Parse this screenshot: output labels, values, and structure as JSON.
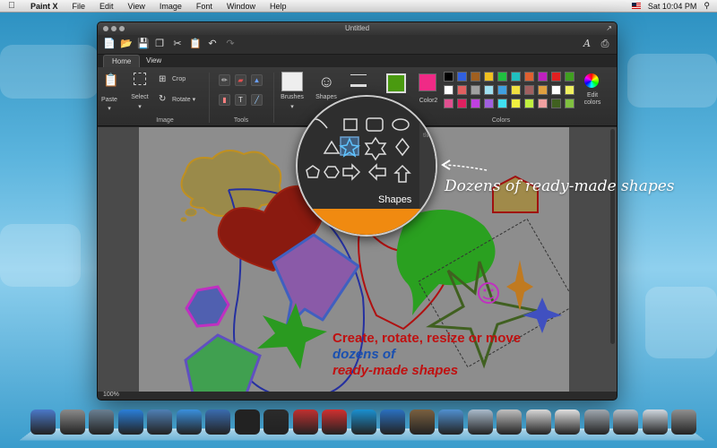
{
  "menubar": {
    "app_name": "Paint X",
    "items": [
      "File",
      "Edit",
      "View",
      "Image",
      "Font",
      "Window",
      "Help"
    ],
    "clock": "Sat 10:04 PM"
  },
  "window": {
    "title": "Untitled"
  },
  "tabs": [
    "Home",
    "View"
  ],
  "ribbon": {
    "paste": "Paste",
    "select": "Select",
    "crop": "Crop",
    "rotate": "Rotate",
    "image_group": "Image",
    "tools_group": "Tools",
    "brushes": "Brushes",
    "shapes": "Shapes",
    "outline": "Outline",
    "color2": "Color2",
    "colors_group": "Colors",
    "edit_colors": "Edit colors",
    "color1_hex": "#4a9a10",
    "color2_hex": "#f02a86",
    "palette": [
      [
        "#000000",
        "#3060e0",
        "#a06020",
        "#f0c020",
        "#20c040",
        "#20c0c0",
        "#e06030",
        "#c020c0",
        "#e02020",
        "#40a020"
      ],
      [
        "#ffffff",
        "#e06060",
        "#a0a0a0",
        "#a0e0f0",
        "#40a0e0",
        "#f0e040",
        "#a06060",
        "#e0a040",
        "#ffffff",
        "#f0f060"
      ],
      [
        "#e05090",
        "#e02060",
        "#c040e0",
        "#a060e0",
        "#40e0f0",
        "#f0f040",
        "#c0f040",
        "#f0a0a0",
        "#406020",
        "#80c040"
      ]
    ]
  },
  "canvas_text": {
    "line1": "Create, rotate, resize or move",
    "line2": "dozens of",
    "line3": "ready-made shapes"
  },
  "magnifier": {
    "label": "Shapes",
    "tab_hint": "tline"
  },
  "callout": "Dozens of ready-made shapes",
  "status": {
    "zoom": "100%"
  },
  "dock_colors": [
    "#4b79c9",
    "#8a8a8a",
    "#6a7f92",
    "#2a7ed8",
    "#4f7fb5",
    "#3a8fdc",
    "#3a6cb0",
    "#222222",
    "#2b2b2b",
    "#c03030",
    "#d03030",
    "#1a90d0",
    "#2a70c0",
    "#7a6040",
    "#5090d0",
    "#aabbcc",
    "#c0c0c0",
    "#d8d8d8",
    "#e0e0e0",
    "#a0a8b0",
    "#b8c0c8",
    "#d0d8e0",
    "#909090"
  ]
}
